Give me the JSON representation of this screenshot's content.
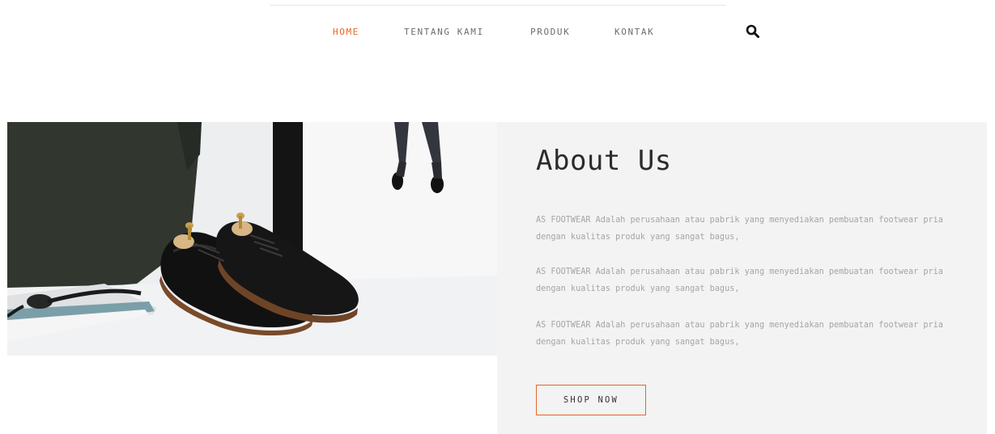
{
  "nav": {
    "items": [
      {
        "label": "HOME",
        "active": true
      },
      {
        "label": "TENTANG KAMI",
        "active": false
      },
      {
        "label": "PRODUK",
        "active": false
      },
      {
        "label": "KONTAK",
        "active": false
      }
    ],
    "search_icon": "search-icon"
  },
  "about": {
    "title": "About Us",
    "paragraphs": [
      "AS FOOTWEAR Adalah perusahaan atau pabrik yang menyediakan pembuatan footwear pria dengan kualitas produk yang sangat bagus,",
      "AS FOOTWEAR Adalah perusahaan atau pabrik yang menyediakan pembuatan footwear pria dengan kualitas produk yang sangat bagus,",
      "AS FOOTWEAR Adalah perusahaan atau pabrik yang menyediakan pembuatan footwear pria dengan kualitas produk yang sangat bagus,"
    ],
    "button_label": "SHOP NOW"
  },
  "colors": {
    "accent": "#e5652a",
    "panel_bg": "#f2f3f2",
    "nav_text": "#6d6d6d",
    "body_text": "#a5a5a5"
  }
}
